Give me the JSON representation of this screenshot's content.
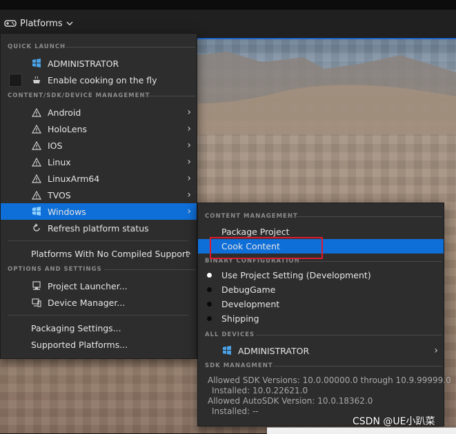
{
  "toolbar": {
    "platforms_label": "Platforms"
  },
  "left_menu": {
    "quick_launch_header": "QUICK LAUNCH",
    "quick_launch_device": "ADMINISTRATOR",
    "cook_on_fly_label": "Enable cooking on the fly",
    "content_mgmt_header": "CONTENT/SDK/DEVICE MANAGEMENT",
    "platforms": [
      {
        "label": "Android"
      },
      {
        "label": "HoloLens"
      },
      {
        "label": "IOS"
      },
      {
        "label": "Linux"
      },
      {
        "label": "LinuxArm64"
      },
      {
        "label": "TVOS"
      },
      {
        "label": "Windows"
      }
    ],
    "refresh_label": "Refresh platform status",
    "no_compiled_label": "Platforms With No Compiled Support",
    "options_header": "OPTIONS AND SETTINGS",
    "project_launcher_label": "Project Launcher...",
    "device_manager_label": "Device Manager...",
    "packaging_settings_label": "Packaging Settings...",
    "supported_platforms_label": "Supported Platforms..."
  },
  "right_menu": {
    "content_header": "CONTENT MANAGEMENT",
    "package_project_label": "Package Project",
    "cook_content_label": "Cook Content",
    "binary_header": "BINARY CONFIGURATION",
    "configs": [
      {
        "label": "Use Project Setting (Development)",
        "selected": true
      },
      {
        "label": "DebugGame",
        "selected": false
      },
      {
        "label": "Development",
        "selected": false
      },
      {
        "label": "Shipping",
        "selected": false
      }
    ],
    "all_devices_header": "ALL DEVICES",
    "device_label": "ADMINISTRATOR",
    "sdk_header": "SDK MANAGMENT",
    "sdk_lines": [
      "Allowed SDK Versions: 10.0.00000.0 through 10.9.99999.0",
      "Installed: 10.0.22621.0",
      "Allowed AutoSDK Version: 10.0.18362.0",
      "Installed: --"
    ]
  },
  "watermark": "CSDN @UE小趴菜",
  "colors": {
    "selection": "#0f6fd8",
    "highlight_box": "#e2192a",
    "menu_bg": "#2d2d2d"
  }
}
